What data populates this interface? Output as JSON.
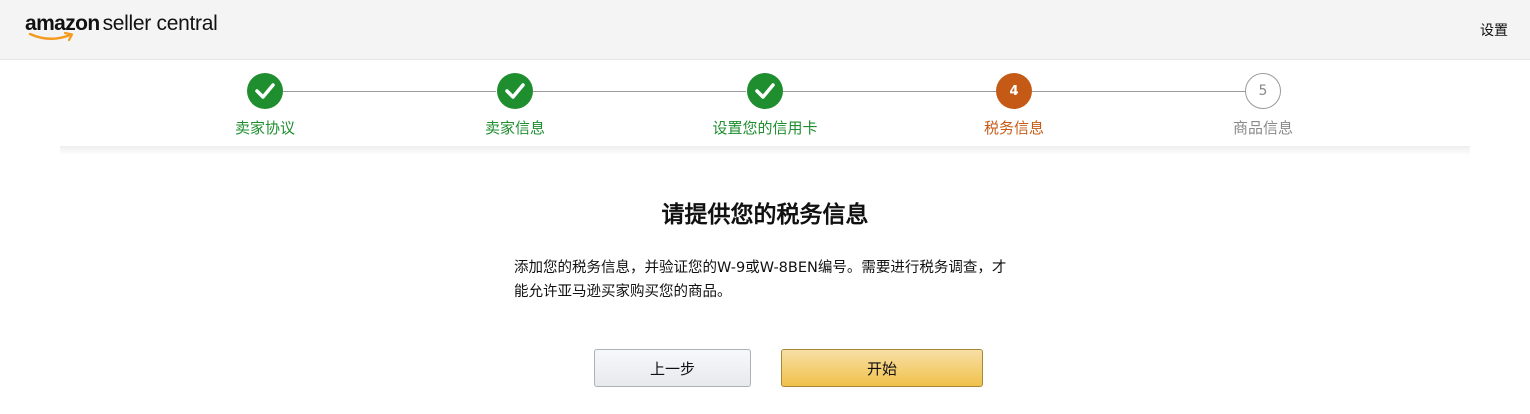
{
  "header": {
    "logo_primary": "amazon",
    "logo_secondary": "seller central",
    "settings_label": "设置"
  },
  "stepper": {
    "steps": [
      {
        "label": "卖家协议",
        "state": "done",
        "marker": "✓"
      },
      {
        "label": "卖家信息",
        "state": "done",
        "marker": "✓"
      },
      {
        "label": "设置您的信用卡",
        "state": "done",
        "marker": "✓"
      },
      {
        "label": "税务信息",
        "state": "current",
        "marker": "4"
      },
      {
        "label": "商品信息",
        "state": "pending",
        "marker": "5"
      }
    ]
  },
  "main": {
    "title": "请提供您的税务信息",
    "description": "添加您的税务信息，并验证您的W-9或W-8BEN编号。需要进行税务调查，才能允许亚马逊买家购买您的商品。"
  },
  "actions": {
    "back_label": "上一步",
    "start_label": "开始"
  },
  "colors": {
    "done": "#1e8e2f",
    "current": "#c45a16",
    "pending": "#8a8a8a",
    "primary_button": "#f0c14b"
  }
}
